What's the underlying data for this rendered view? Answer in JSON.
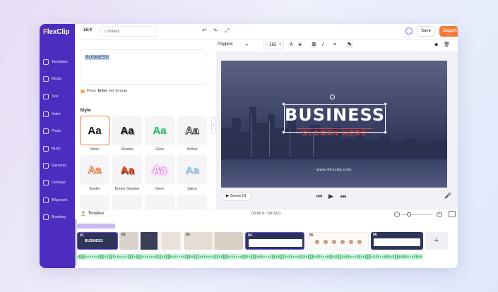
{
  "brand": {
    "logo": "FlexClip",
    "accent": "#4d2dbf",
    "export_color": "#f27b3a"
  },
  "topbar": {
    "ratio": "16:9",
    "title_placeholder": "Untitled",
    "save_label": "Save",
    "export_label": "Export →"
  },
  "sidebar": {
    "items": [
      {
        "label": "Templates",
        "icon": "templates-icon"
      },
      {
        "label": "Media",
        "icon": "media-icon"
      },
      {
        "label": "Text",
        "icon": "text-icon"
      },
      {
        "label": "Video",
        "icon": "video-icon"
      },
      {
        "label": "Photo",
        "icon": "photo-icon"
      },
      {
        "label": "Music",
        "icon": "music-icon"
      },
      {
        "label": "Elements",
        "icon": "elements-icon"
      },
      {
        "label": "Overlays",
        "icon": "overlays-icon"
      },
      {
        "label": "BKground",
        "icon": "background-icon"
      },
      {
        "label": "Branding",
        "icon": "branding-icon"
      }
    ]
  },
  "panel": {
    "text_value": "BUSINESS",
    "hint_prefix": "Press",
    "hint_key": "Enter",
    "hint_suffix": "key to wrap",
    "style_title": "Style",
    "styles": [
      {
        "sample": "Aa",
        "label": "None"
      },
      {
        "sample": "Aa",
        "label": "Shadow"
      },
      {
        "sample": "Aa",
        "label": "Glow"
      },
      {
        "sample": "Aa",
        "label": "Hollow"
      },
      {
        "sample": "Aa",
        "label": "Border"
      },
      {
        "sample": "Aa",
        "label": "Border Shadow"
      },
      {
        "sample": "Aa",
        "label": "Neon"
      },
      {
        "sample": "Aa",
        "label": "Splice"
      }
    ]
  },
  "format_bar": {
    "font": "Poppins",
    "size": "162",
    "minus": "-",
    "plus": "+"
  },
  "preview": {
    "headline": "BUSINESS",
    "slogan": "SLOGAN HERE",
    "site": "www.flexclip.com",
    "scene_label": "Scene 01"
  },
  "timeline": {
    "title": "Timeline",
    "time": "00:00.0 / 00:33.0",
    "clips": [
      "01",
      "02",
      "03",
      "04",
      "05",
      "06"
    ],
    "clip_title": "BUSINESS",
    "add_label": "+"
  }
}
